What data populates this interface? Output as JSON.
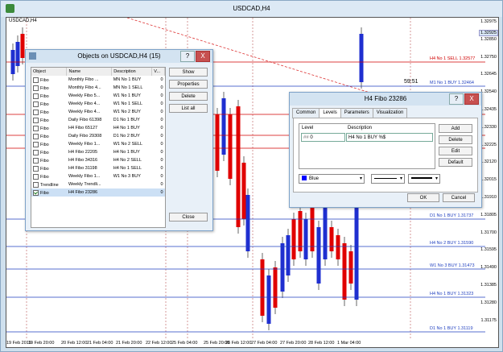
{
  "window": {
    "title": "USDCAD,H4",
    "symbol_label": "USDCAD,H4"
  },
  "prices": [
    "1.32975",
    "1.32850",
    "1.32750",
    "1.32645",
    "1.32540",
    "1.32435",
    "1.32330",
    "1.32225",
    "1.32120",
    "1.32015",
    "1.31910",
    "1.31805",
    "1.31700",
    "1.31595",
    "1.31490",
    "1.31385",
    "1.31280",
    "1.31175"
  ],
  "current_price": "1.32925",
  "countdown": "59:51",
  "levels": [
    {
      "label": "H4 No 1 SELL 1.32577",
      "color": "#d00000"
    },
    {
      "label": "M1 No 1 BUY 1.32464",
      "color": "#1f3fbf"
    },
    {
      "label": "D1 No 1 BUY 1.31737",
      "color": "#1f3fbf"
    },
    {
      "label": "H4 No 2 BUY 1.31590",
      "color": "#1f3fbf"
    },
    {
      "label": "W1 No 3 BUY 1.31473",
      "color": "#1f3fbf"
    },
    {
      "label": "H4 No 1 BUY 1.31323",
      "color": "#1f3fbf"
    },
    {
      "label": "D1 No 1 BUY 1.31119",
      "color": "#1f3fbf"
    }
  ],
  "dates": [
    "19 Feb 2019",
    "19 Feb 20:00",
    "20 Feb 12:00",
    "21 Feb 04:00",
    "21 Feb 20:00",
    "22 Feb 12:00",
    "25 Feb 04:00",
    "25 Feb 20:00",
    "26 Feb 12:00",
    "27 Feb 04:00",
    "27 Feb 20:00",
    "28 Feb 12:00",
    "1 Mar 04:00"
  ],
  "objects_dialog": {
    "title": "Objects on USDCAD,H4 (15)",
    "headers": [
      "Object",
      "Name",
      "Description",
      "V..."
    ],
    "rows": [
      {
        "object": "Fibo",
        "name": "Monthly Fibo ...",
        "desc": "MN No 1 BUY",
        "v": "0",
        "checked": false
      },
      {
        "object": "Fibo",
        "name": "Monthly Fibo 4...",
        "desc": "MN No 1 SELL",
        "v": "0",
        "checked": false
      },
      {
        "object": "Fibo",
        "name": "Weekly Fibo 5...",
        "desc": "W1 No 1 BUY",
        "v": "0",
        "checked": false
      },
      {
        "object": "Fibo",
        "name": "Weekly Fibo 4...",
        "desc": "W1 No 1 SELL",
        "v": "0",
        "checked": false
      },
      {
        "object": "Fibo",
        "name": "Weekly Fibo 4...",
        "desc": "W1 No 2 BUY",
        "v": "0",
        "checked": false
      },
      {
        "object": "Fibo",
        "name": "Daily Fibo 61398",
        "desc": "D1 No 1 BUY",
        "v": "0",
        "checked": false
      },
      {
        "object": "Fibo",
        "name": "H4 Fibo 65127",
        "desc": "H4 No 1 BUY",
        "v": "0",
        "checked": false
      },
      {
        "object": "Fibo",
        "name": "Daily Fibo 29308",
        "desc": "D1 No 2 BUY",
        "v": "0",
        "checked": false
      },
      {
        "object": "Fibo",
        "name": "Weekly Fibo 1...",
        "desc": "W1 No 2 SELL",
        "v": "0",
        "checked": false
      },
      {
        "object": "Fibo",
        "name": "H4 Fibo 22205",
        "desc": "H4 No 1 BUY",
        "v": "0",
        "checked": false
      },
      {
        "object": "Fibo",
        "name": "H4 Fibo 34316",
        "desc": "H4 No 2 SELL",
        "v": "0",
        "checked": false
      },
      {
        "object": "Fibo",
        "name": "H4 Fibo 31198",
        "desc": "H4 No 1 SELL",
        "v": "0",
        "checked": false
      },
      {
        "object": "Fibo",
        "name": "Weekly Fibo 1...",
        "desc": "W1 No 3 BUY",
        "v": "0",
        "checked": false
      },
      {
        "object": "Trendline",
        "name": "Weekly Trendli...",
        "desc": "",
        "v": "0",
        "checked": false
      },
      {
        "object": "Fibo",
        "name": "H4 Fibo 23286",
        "desc": "",
        "v": "0",
        "checked": true
      }
    ],
    "buttons": {
      "show": "Show",
      "properties": "Properties",
      "delete": "Delete",
      "list_all": "List all",
      "close": "Close"
    },
    "help": "?",
    "close_x": "X"
  },
  "fibo_dialog": {
    "title": "H4 Fibo 23286",
    "tabs": [
      "Common",
      "Levels",
      "Parameters",
      "Visualization"
    ],
    "col_level": "Level",
    "col_description": "Description",
    "level_value": "0",
    "description_value": "H4 No 1 BUY %$",
    "buttons": {
      "add": "Add",
      "delete": "Delete",
      "edit": "Edit",
      "default": "Default",
      "ok": "OK",
      "cancel": "Cancel"
    },
    "color_name": "Blue",
    "color_hex": "#0000ff",
    "help": "?",
    "close_x": "X"
  }
}
